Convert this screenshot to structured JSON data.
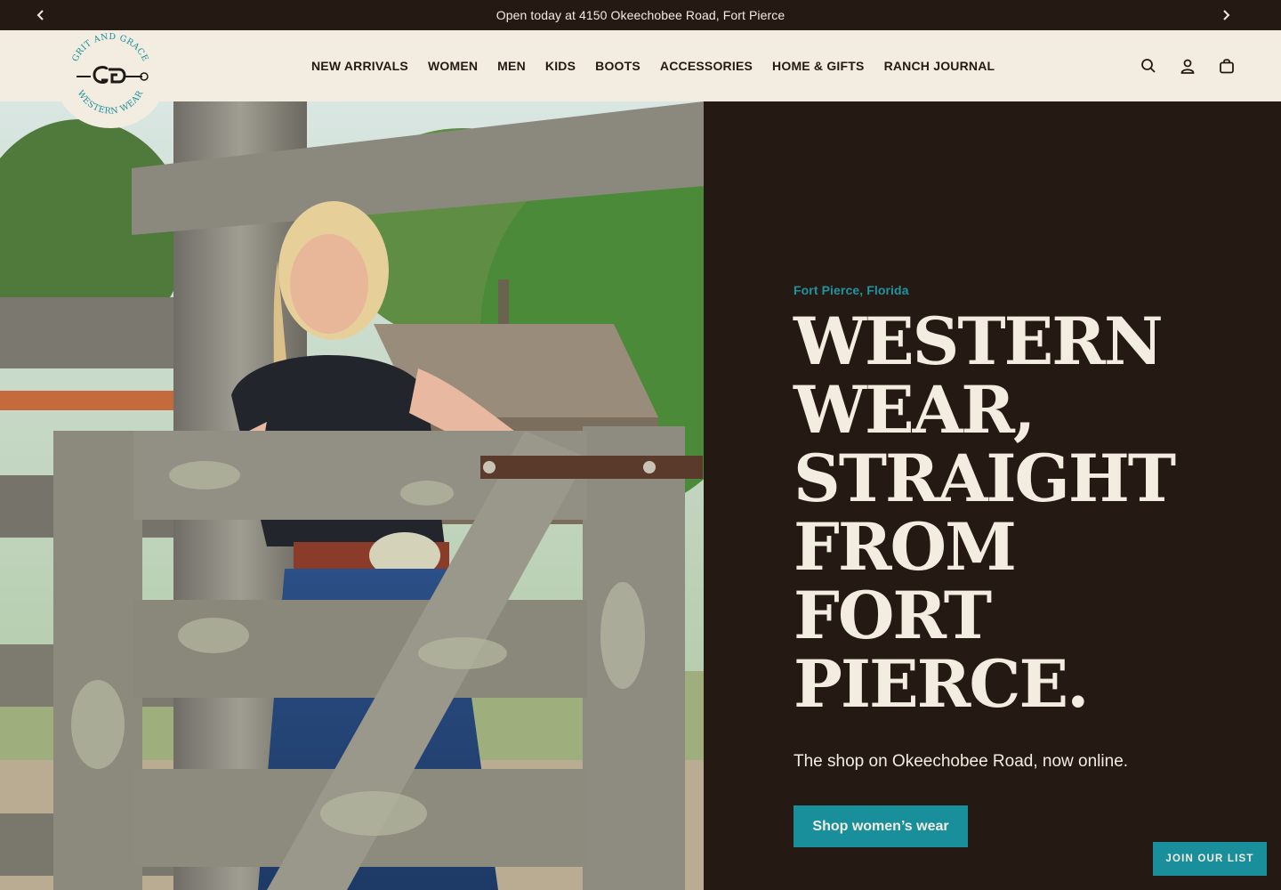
{
  "announcement": {
    "text": "Open today at 4150 Okeechobee Road, Fort Pierce",
    "prev_icon": "chevron-left-icon",
    "next_icon": "chevron-right-icon"
  },
  "brand": {
    "logo_top_text": "GRIT AND GRACE",
    "logo_bottom_text": "WESTERN WEAR",
    "logo_monogram": "GG"
  },
  "nav": {
    "items": [
      {
        "label": "NEW ARRIVALS"
      },
      {
        "label": "WOMEN"
      },
      {
        "label": "MEN"
      },
      {
        "label": "KIDS"
      },
      {
        "label": "BOOTS"
      },
      {
        "label": "ACCESSORIES"
      },
      {
        "label": "HOME & GIFTS"
      },
      {
        "label": "RANCH JOURNAL"
      }
    ]
  },
  "header_icons": [
    "search-icon",
    "account-icon",
    "cart-icon"
  ],
  "hero": {
    "eyebrow": "Fort Pierce, Florida",
    "headline": "WESTERN\nWEAR,\nSTRAIGHT\nFROM\nFORT\nPIERCE.",
    "subhead": "The shop on Okeechobee Road, now online.",
    "cta_label": "Shop women’s wear"
  },
  "signup": {
    "label": "JOIN OUR LIST"
  },
  "colors": {
    "dark": "#241a13",
    "cream": "#f3ece0",
    "teal": "#1a8f9c"
  }
}
